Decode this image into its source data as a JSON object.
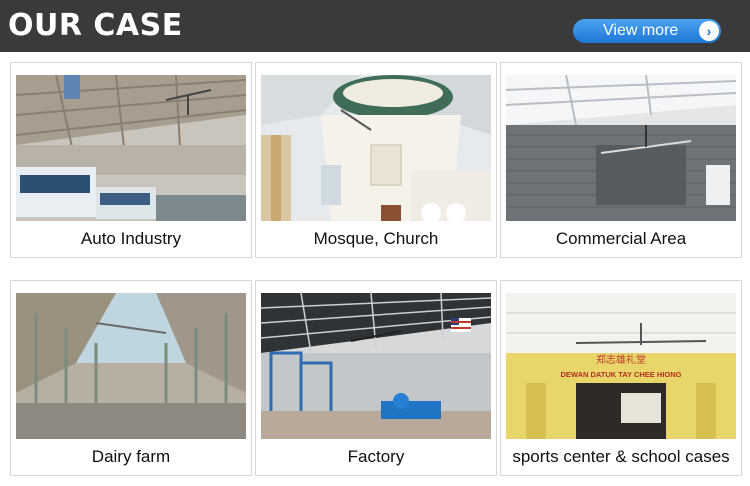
{
  "header": {
    "title": "OUR CASE",
    "view_more": "View more"
  },
  "cases": [
    {
      "label": "Auto Industry"
    },
    {
      "label": "Mosque, Church"
    },
    {
      "label": "Commercial Area"
    },
    {
      "label": "Dairy farm"
    },
    {
      "label": "Factory"
    },
    {
      "label": "sports center & school cases"
    }
  ],
  "photo_text": {
    "sign_chinese": "郑志雄礼堂",
    "sign_latin": "DEWAN DATUK TAY CHEE HIONG"
  }
}
